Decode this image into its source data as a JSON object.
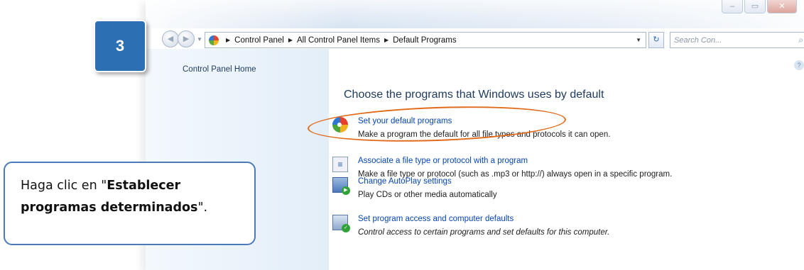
{
  "step_badge": {
    "number": "3"
  },
  "callout": {
    "text_before": "Haga clic en \"",
    "bold_text": "Establecer programas determinados",
    "text_after": "\"."
  },
  "window": {
    "address": {
      "crumbs": [
        "Control Panel",
        "All Control Panel Items",
        "Default Programs"
      ]
    },
    "search": {
      "placeholder": "Search Con..."
    },
    "sidebar": {
      "home_link": "Control Panel Home"
    },
    "main": {
      "title": "Choose the programs that Windows uses by default",
      "tasks": [
        {
          "link": "Set your default programs",
          "description": "Make a program the default for all file types and protocols it can open.",
          "icon": "default-programs-icon"
        },
        {
          "link": "Associate a file type or protocol with a program",
          "description": "Make a file type or protocol (such as .mp3 or http://) always open in a specific program.",
          "icon": "file-association-icon"
        },
        {
          "link": "Change AutoPlay settings",
          "description": "Play CDs or other media automatically",
          "icon": "autoplay-icon"
        },
        {
          "link": "Set program access and computer defaults",
          "description": "Control access to certain programs and set defaults for this computer.",
          "icon": "program-access-icon"
        }
      ]
    }
  },
  "colors": {
    "accent": "#2c6fb3",
    "highlight": "#e06a1a",
    "link": "#0645ad"
  }
}
